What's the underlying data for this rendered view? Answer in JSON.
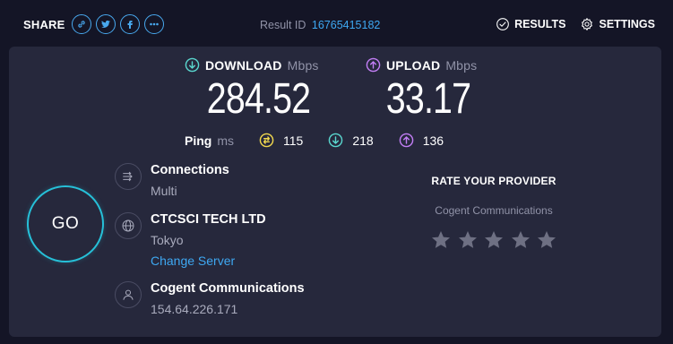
{
  "topbar": {
    "share_label": "SHARE",
    "share_buttons": [
      "link-icon",
      "twitter-icon",
      "facebook-icon",
      "more-icon"
    ],
    "result_label": "Result ID",
    "result_id": "16765415182",
    "results_label": "RESULTS",
    "settings_label": "SETTINGS"
  },
  "download": {
    "label": "DOWNLOAD",
    "unit": "Mbps",
    "value": "284.52",
    "color": "#5ad7cf"
  },
  "upload": {
    "label": "UPLOAD",
    "unit": "Mbps",
    "value": "33.17",
    "color": "#c27ef5"
  },
  "ping": {
    "label": "Ping",
    "unit": "ms",
    "idle": "115",
    "download": "218",
    "upload": "136",
    "idle_color": "#f2d94e"
  },
  "go_label": "GO",
  "connections": {
    "title": "Connections",
    "value": "Multi"
  },
  "server": {
    "name": "CTCSCI TECH LTD",
    "location": "Tokyo",
    "change_label": "Change Server"
  },
  "isp": {
    "name": "Cogent Communications",
    "ip": "154.64.226.171"
  },
  "rate": {
    "title": "RATE YOUR PROVIDER",
    "provider": "Cogent Communications",
    "stars": 5,
    "star_color": "#6e7083"
  },
  "colors": {
    "accent": "#3ea8f2",
    "go_ring": "#26c0d8",
    "panel": "#26283c",
    "background": "#141526"
  }
}
